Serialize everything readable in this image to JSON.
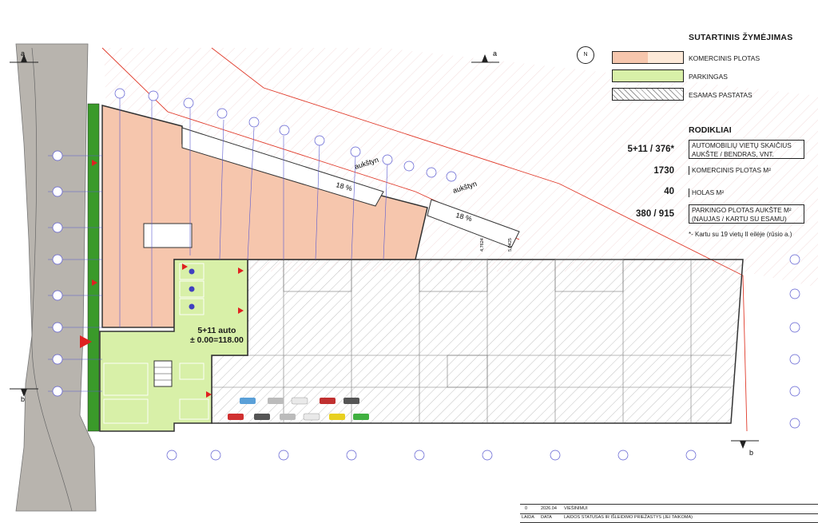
{
  "legend": {
    "title": "SUTARTINIS ŽYMĖJIMAS",
    "items": [
      {
        "label": "KOMERCINIS PLOTAS",
        "color": "#f6c6ad"
      },
      {
        "label": "PARKINGAS",
        "color": "#d8f0a8"
      },
      {
        "label": "ESAMAS PASTATAS",
        "color": "hatch"
      }
    ]
  },
  "indicators": {
    "title": "RODIKLIAI",
    "rows": [
      {
        "value": "5+11 / 376*",
        "label": "AUTOMOBILIŲ VIETŲ SKAIČIUS AUKŠTE / BENDRAS, VNT."
      },
      {
        "value": "1730",
        "label": "KOMERCINIS PLOTAS M²"
      },
      {
        "value": "40",
        "label": "HOLAS M²"
      },
      {
        "value": "380 / 915",
        "label": "PARKINGO PLOTAS AUKŠTE M² (NAUJAS / KARTU SU ESAMU)"
      }
    ],
    "footnote": "*- Kartu su 19 vietų II eilėje (rūsio a.)"
  },
  "plan": {
    "parking_label_line1": "5+11 auto",
    "parking_label_line2": "± 0.00=118.00",
    "ramp_label_1": "aukštyn",
    "ramp_label_2": "aukštyn",
    "slope_1": "18 %",
    "slope_2": "18 %",
    "north": "N",
    "section_a": "a",
    "section_b": "b",
    "dim_1": "4,7624",
    "dim_2": "5,0425",
    "colors": {
      "commercial": "#f6c6ad",
      "parking": "#d8f0a8",
      "green_strip": "#3a9a2a",
      "road": "#b8b4ae",
      "grid": "#5a5ad0",
      "outline": "#333333",
      "red_line": "#e03a2a"
    }
  },
  "title_block": {
    "rev": "0",
    "date": "2026.04",
    "status": "VIEŠINIMUI",
    "col_rev": "LAIDA",
    "col_date": "DATA",
    "col_status": "LAIDOS STATUSAS IR IŠLEIDIMO PRIEŽASTYS (JEI TAIKOMA)"
  }
}
